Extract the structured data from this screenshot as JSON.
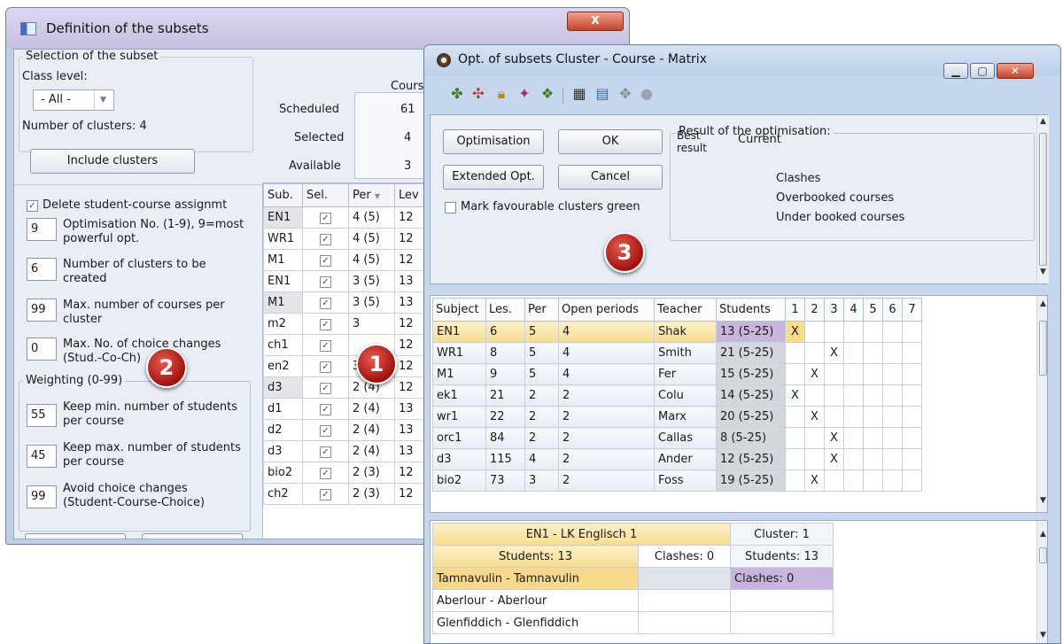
{
  "win1": {
    "title": "Definition of the subsets",
    "close": "X",
    "selection": {
      "group": "Selection of the subset",
      "class_level_label": "Class level:",
      "class_level_value": "- All -",
      "clusters_label": "Number of clusters: 4",
      "include_btn": "Include clusters"
    },
    "courses": {
      "header": "Courses",
      "rows": [
        {
          "label": "Scheduled",
          "value": "61"
        },
        {
          "label": "Selected",
          "value": "4"
        },
        {
          "label": "Available",
          "value": "3"
        }
      ]
    },
    "delete_label": "Delete student-course assignmt",
    "params": [
      {
        "value": "9",
        "label": "Optimisation No. (1-9), 9=most powerful opt."
      },
      {
        "value": "6",
        "label": "Number of clusters to be created"
      },
      {
        "value": "99",
        "label": "Max. number of courses per cluster"
      },
      {
        "value": "0",
        "label": "Max. No. of choice changes (Stud.-Co-Ch)"
      }
    ],
    "weighting": {
      "group": "Weighting (0-99)",
      "params": [
        {
          "value": "55",
          "label": "Keep min. number of students per course"
        },
        {
          "value": "45",
          "label": "Keep max. number of students per course"
        },
        {
          "value": "99",
          "label": "Avoid choice changes (Student-Course-Choice)"
        }
      ]
    },
    "table": {
      "headers": [
        "Sub.",
        "Sel.",
        "Per",
        "Lev"
      ],
      "rows": [
        [
          "EN1",
          "4 (5)",
          "12"
        ],
        [
          "WR1",
          "4 (5)",
          "12"
        ],
        [
          "M1",
          "4 (5)",
          "12"
        ],
        [
          "EN1",
          "3 (5)",
          "13"
        ],
        [
          "M1",
          "3 (5)",
          "13"
        ],
        [
          "m2",
          "3",
          "12"
        ],
        [
          "ch1",
          "",
          "12"
        ],
        [
          "en2",
          "3 (3)",
          "12"
        ],
        [
          "d3",
          "2 (4)",
          "12"
        ],
        [
          "d1",
          "2 (4)",
          "13"
        ],
        [
          "d2",
          "2 (4)",
          "13"
        ],
        [
          "d3",
          "2 (4)",
          "13"
        ],
        [
          "bio2",
          "2 (3)",
          "12"
        ],
        [
          "ch2",
          "2 (3)",
          "12"
        ]
      ]
    }
  },
  "badges": [
    "1",
    "2",
    "3"
  ],
  "win2": {
    "title": "Opt. of subsets Cluster - Course - Matrix",
    "buttons": {
      "optimisation": "Optimisation",
      "ok": "OK",
      "extended": "Extended Opt.",
      "cancel": "Cancel"
    },
    "mark_green": "Mark favourable clusters green",
    "result": {
      "group": "Result of the optimisation:",
      "best": "Best result",
      "current": "Current",
      "clashes": "Clashes",
      "overbooked": "Overbooked courses",
      "underbooked": "Under booked courses"
    },
    "matrix": {
      "headers": [
        "Subject",
        "Les.",
        "Per",
        "Open periods",
        "Teacher",
        "Students",
        "1",
        "2",
        "3",
        "4",
        "5",
        "6",
        "7"
      ],
      "rows": [
        {
          "subject": "EN1",
          "les": "6",
          "per": "5",
          "open": "4",
          "teacher": "Shak",
          "students": "13 (5-25)",
          "col": 1
        },
        {
          "subject": "WR1",
          "les": "8",
          "per": "5",
          "open": "4",
          "teacher": "Smith",
          "students": "21 (5-25)",
          "col": 3
        },
        {
          "subject": "M1",
          "les": "9",
          "per": "5",
          "open": "4",
          "teacher": "Fer",
          "students": "15 (5-25)",
          "col": 2
        },
        {
          "subject": "ek1",
          "les": "21",
          "per": "2",
          "open": "2",
          "teacher": "Colu",
          "students": "14 (5-25)",
          "col": 1
        },
        {
          "subject": "wr1",
          "les": "22",
          "per": "2",
          "open": "2",
          "teacher": "Marx",
          "students": "20 (5-25)",
          "col": 2
        },
        {
          "subject": "orc1",
          "les": "84",
          "per": "2",
          "open": "2",
          "teacher": "Callas",
          "students": "8 (5-25)",
          "col": 3
        },
        {
          "subject": "d3",
          "les": "115",
          "per": "4",
          "open": "2",
          "teacher": "Ander",
          "students": "12 (5-25)",
          "col": 3
        },
        {
          "subject": "bio2",
          "les": "73",
          "per": "3",
          "open": "2",
          "teacher": "Foss",
          "students": "19 (5-25)",
          "col": 2
        }
      ],
      "mark": "X"
    },
    "bottom": {
      "course": "EN1 - LK Englisch 1",
      "cluster": "Cluster: 1",
      "students": "Students: 13",
      "clashes": "Clashes: 0",
      "students2": "Students: 13",
      "clashes2": "Clashes: 0",
      "names": [
        "Tamnavulin - Tamnavulin",
        "Aberlour - Aberlour",
        "Glenfiddich - Glenfiddich"
      ]
    }
  }
}
